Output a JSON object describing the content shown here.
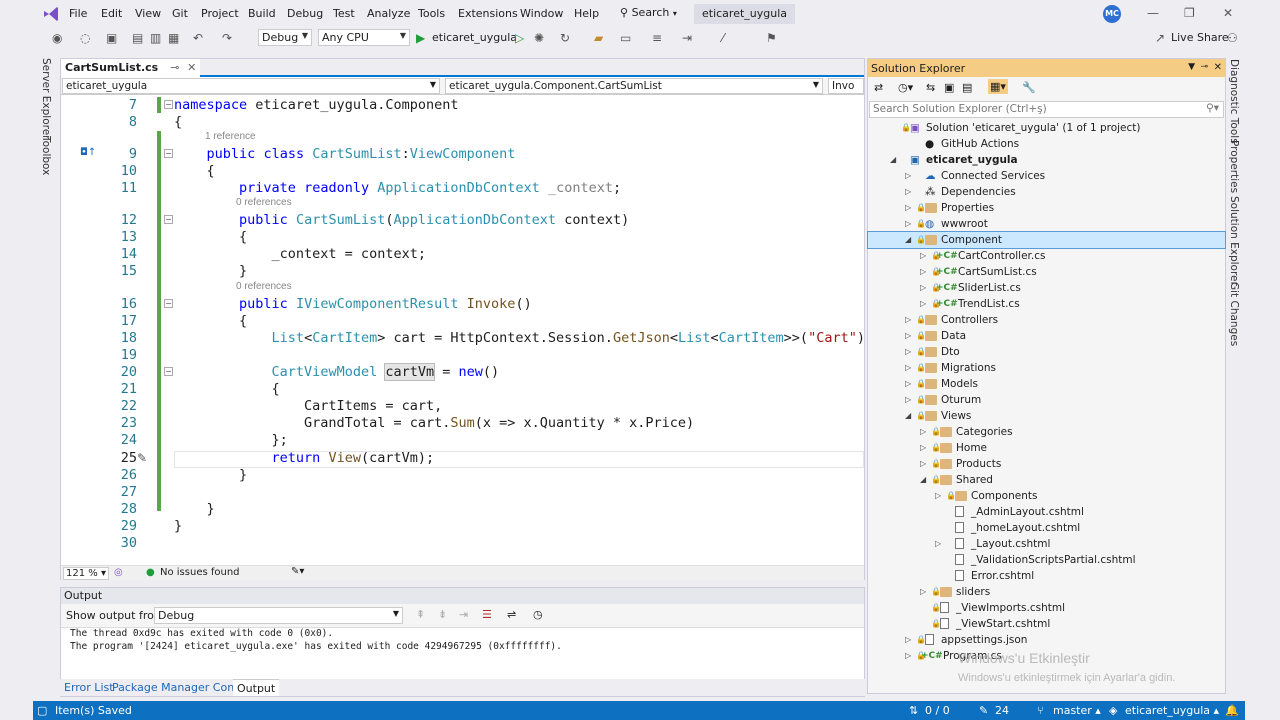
{
  "menubar": {
    "items": [
      "File",
      "Edit",
      "View",
      "Git",
      "Project",
      "Build",
      "Debug",
      "Test",
      "Analyze",
      "Tools",
      "Extensions",
      "Window",
      "Help"
    ],
    "search_label": "Search",
    "solution_name": "eticaret_uygula",
    "avatar_initials": "MC"
  },
  "toolbar": {
    "config": "Debug",
    "platform": "Any CPU",
    "run_target": "eticaret_uygula",
    "live_share": "Live Share"
  },
  "siderail": {
    "left": [
      "Server Explorer",
      "Toolbox"
    ],
    "right": [
      "Diagnostic Tools",
      "Properties",
      "Solution Explorer",
      "Git Changes"
    ]
  },
  "editor": {
    "tab": "CartSumList.cs",
    "nav": [
      "eticaret_uygula",
      "eticaret_uygula.Component.CartSumList",
      "Invo"
    ],
    "zoom": "121 %",
    "issues": "No issues found",
    "lines": [
      {
        "n": "7",
        "text": "namespace eticaret_uygula.Component"
      },
      {
        "n": "8",
        "text": "{"
      },
      {
        "n": "9",
        "text": "    public class CartSumList:ViewComponent"
      },
      {
        "n": "10",
        "text": "    {"
      },
      {
        "n": "11",
        "text": "        private readonly ApplicationDbContext _context;"
      },
      {
        "n": "12",
        "text": "        public CartSumList(ApplicationDbContext context)"
      },
      {
        "n": "13",
        "text": "        {"
      },
      {
        "n": "14",
        "text": "            _context = context;"
      },
      {
        "n": "15",
        "text": "        }"
      },
      {
        "n": "16",
        "text": "        public IViewComponentResult Invoke()"
      },
      {
        "n": "17",
        "text": "        {"
      },
      {
        "n": "18",
        "text": "            List<CartItem> cart = HttpContext.Session.GetJson<List<CartItem>>(\"Cart\") ?? n"
      },
      {
        "n": "19",
        "text": ""
      },
      {
        "n": "20",
        "text": "            CartViewModel cartVm = new()"
      },
      {
        "n": "21",
        "text": "            {"
      },
      {
        "n": "22",
        "text": "                CartItems = cart,"
      },
      {
        "n": "23",
        "text": "                GrandTotal = cart.Sum(x => x.Quantity * x.Price)"
      },
      {
        "n": "24",
        "text": "            };"
      },
      {
        "n": "25",
        "text": "            return View(cartVm);"
      },
      {
        "n": "26",
        "text": "        }"
      },
      {
        "n": "27",
        "text": ""
      },
      {
        "n": "28",
        "text": "    }"
      },
      {
        "n": "29",
        "text": "}"
      },
      {
        "n": "30",
        "text": ""
      }
    ],
    "lens": [
      "1 reference",
      "0 references",
      "0 references"
    ]
  },
  "output": {
    "title": "Output",
    "show_from_label": "Show output from:",
    "show_from_value": "Debug",
    "lines": [
      "The thread 0xd9c has exited with code 0 (0x0).",
      "The program '[2424] eticaret_uygula.exe' has exited with code 4294967295 (0xffffffff)."
    ]
  },
  "bottom_tabs": [
    "Error List",
    "Package Manager Console",
    "Output"
  ],
  "solution_explorer": {
    "title": "Solution Explorer",
    "search_placeholder": "Search Solution Explorer (Ctrl+ş)",
    "tree": [
      "Solution 'eticaret_uygula' (1 of 1 project)",
      "GitHub Actions",
      "eticaret_uygula",
      "Connected Services",
      "Dependencies",
      "Properties",
      "wwwroot",
      "Component",
      "CartController.cs",
      "CartSumList.cs",
      "SliderList.cs",
      "TrendList.cs",
      "Controllers",
      "Data",
      "Dto",
      "Migrations",
      "Models",
      "Oturum",
      "Views",
      "Categories",
      "Home",
      "Products",
      "Shared",
      "Components",
      "_AdminLayout.cshtml",
      "_homeLayout.cshtml",
      "_Layout.cshtml",
      "_ValidationScriptsPartial.cshtml",
      "Error.cshtml",
      "sliders",
      "_ViewImports.cshtml",
      "_ViewStart.cshtml",
      "appsettings.json",
      "Program.cs"
    ]
  },
  "watermark": {
    "line1": "Windows'u Etkinleştir",
    "line2": "Windows'u etkinleştirmek için Ayarlar'a gidin."
  },
  "statusbar": {
    "saved": "Item(s) Saved",
    "changes": "0 / 0",
    "edits": "24",
    "branch": "master",
    "repo": "eticaret_uygula"
  }
}
